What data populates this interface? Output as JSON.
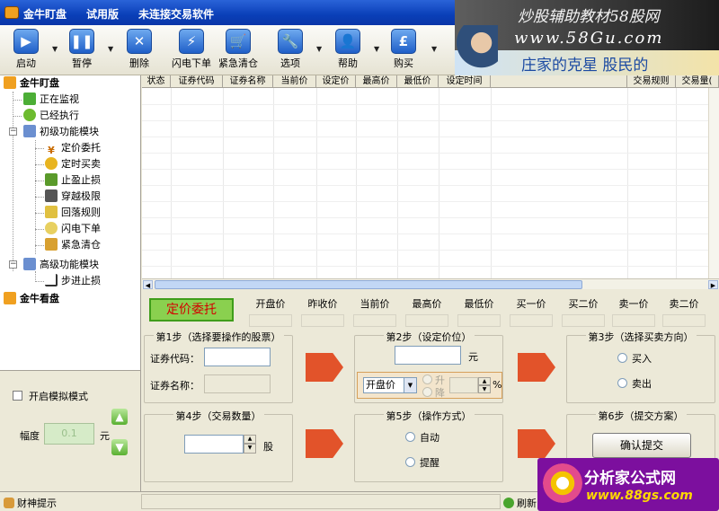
{
  "window": {
    "title": "金牛盯盘",
    "edition": "试用版",
    "status_notice": "未连接交易软件"
  },
  "toolbar": {
    "buttons": [
      {
        "label": "启动",
        "icon": "play-icon"
      },
      {
        "label": "暂停",
        "icon": "pause-icon"
      },
      {
        "label": "删除",
        "icon": "delete-icon"
      },
      {
        "label": "闪电下单",
        "icon": "lightning-icon"
      },
      {
        "label": "紧急清仓",
        "icon": "cart-icon"
      },
      {
        "label": "选项",
        "icon": "wrench-icon"
      },
      {
        "label": "帮助",
        "icon": "user-help-icon"
      },
      {
        "label": "购买",
        "icon": "pound-icon"
      }
    ]
  },
  "banner": {
    "watermark_title": "炒股辅助教材58股网",
    "watermark_url": "www.58Gu.com",
    "ad_slogan": "庄家的克星  股民的"
  },
  "tree": {
    "root1": "金牛盯盘",
    "monitoring": "正在监视",
    "executed": "已经执行",
    "basic_module": "初级功能模块",
    "basic_items": [
      "定价委托",
      "定时买卖",
      "止盈止损",
      "穿越极限",
      "回落规则",
      "闪电下单",
      "紧急清仓"
    ],
    "advanced_module": "高级功能模块",
    "advanced_items": [
      "步进止损"
    ],
    "root2": "金牛看盘"
  },
  "sim": {
    "toggle_label": "开启模拟模式",
    "amplitude_label": "幅度",
    "amplitude_value": "0.1",
    "amplitude_unit": "元"
  },
  "grid": {
    "columns": [
      "状态",
      "证券代码",
      "证券名称",
      "当前价",
      "设定价",
      "最高价",
      "最低价",
      "设定时间",
      "",
      "交易规则",
      "交易量("
    ]
  },
  "price_strip": {
    "order_type": "定价委托",
    "columns": [
      "开盘价",
      "昨收价",
      "当前价",
      "最高价",
      "最低价",
      "买一价",
      "买二价",
      "卖一价",
      "卖二价"
    ]
  },
  "steps": {
    "step1": {
      "title": "第1步（选择要操作的股票）",
      "code_label": "证券代码：",
      "name_label": "证券名称："
    },
    "step2": {
      "title": "第2步（设定价位）",
      "unit": "元",
      "base_select": "开盘价",
      "rise_label": "升",
      "fall_label": "降",
      "percent": "%"
    },
    "step3": {
      "title": "第3步（选择买卖方向）",
      "buy": "买入",
      "sell": "卖出"
    },
    "step4": {
      "title": "第4步（交易数量）",
      "unit": "股"
    },
    "step5": {
      "title": "第5步（操作方式）",
      "auto": "自动",
      "remind": "提醒"
    },
    "step6": {
      "title": "第6步（提交方案）",
      "submit": "确认提交"
    }
  },
  "statusbar": {
    "left": "财神提示",
    "right": "刷新"
  },
  "ad_logo": {
    "title": "分析家公式网",
    "url": "www.88gs.com"
  }
}
